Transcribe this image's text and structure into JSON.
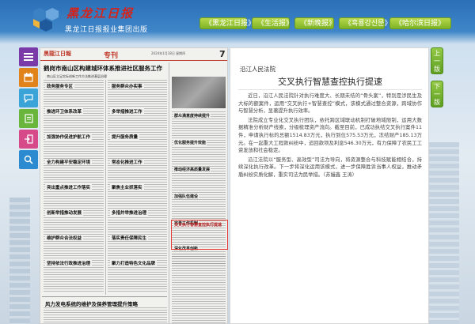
{
  "header": {
    "logo_title": "黑龙江日报",
    "logo_subtitle": "黑龙江日报报业集团出版",
    "tabs": [
      {
        "label": "《黑龙江日报》"
      },
      {
        "label": "《生活报》"
      },
      {
        "label": "《新晚报》"
      },
      {
        "label": "《흑룡강신문》"
      },
      {
        "label": "《哈尔滨日报》"
      }
    ]
  },
  "side": {
    "prev_label": [
      "上",
      "一",
      "版"
    ],
    "next_label": [
      "下",
      "一",
      "版"
    ]
  },
  "toolbar": {
    "icons": [
      "menu-icon",
      "calendar-icon",
      "chat-icon",
      "document-icon",
      "exit-icon",
      "search-icon"
    ]
  },
  "paper": {
    "logo": "黑龍江日報",
    "section": "专刊",
    "page_number": "7",
    "date": "2024年1月18日 星期四",
    "main_headline": "鹤岗市南山区构建城环体系推进社区服务工作",
    "main_sub": "南山区立足实际创新工作方法推进基层治理",
    "col1_headlines": [
      "政务服务专区",
      "推进环卫体系改革",
      "加强协作促进护航工作",
      "全力构建平安稳定环境",
      "突出重点推进工作落实",
      "创新举措推动发展",
      "维护群众合法权益",
      "坚持依法行政推进治理",
      "服务群众办实事",
      "多举措推进工作",
      "提升服务质量",
      "常态化推进工作",
      "聚焦主业抓落实",
      "多措并举推进治理",
      "落实责任保障民生",
      "聚力打造特色文化品牌"
    ],
    "bottom_headline": "风力发电系统的维护及保养管理提升策略",
    "right_col_headlines": [
      "群众满意度持续提升",
      "优化服务提升效能",
      "推动经济高质量发展",
      "加强队伍建设",
      "完善工作机制",
      "深化改革创新"
    ],
    "boxed_headline": "交叉执行智慧查控执行提速"
  },
  "article": {
    "source": "沿江人民法院",
    "title": "交叉执行智慧查控执行提速",
    "paragraphs": [
      "近日，沿江人民法院针对执行难度大、长期未结的“骨头案”，特别是涉民生及大标的额案件，运用“交叉执行+智慧查控”模式，该模式通过整合资源，跨域协作与智慧分析，显著提升执行效率。",
      "法院成立专业化交叉执行团队，依托跨区域联动机制打破地域限制，运用大数据精准分析财产线索，分级梳理资产流向。截至目前，已成功执结交叉执行案件11件，申请执行标的总额1514.83万元，执行到位575.53万元，冻结财产185.13万元。在一起重大工程款纠纷中，追回款项及利息546.30万元，有力保障了农民工工资发放和社会稳定。",
      "沿江法院以“服务型、高效型”司法为导向，将资源整合与科技赋能相结合，持续深化执行改革。下一步将深化运用该模式，进一步保障胜诉当事人权益，推动矛盾纠纷实质化解，重实司法为民举措。（苏嫚鑫 王涛）"
    ]
  },
  "colors": {
    "header_blue": "#2b70b8",
    "tab_green": "#7fb226",
    "logo_red": "#d4231b",
    "highlight_red": "#e53935"
  }
}
